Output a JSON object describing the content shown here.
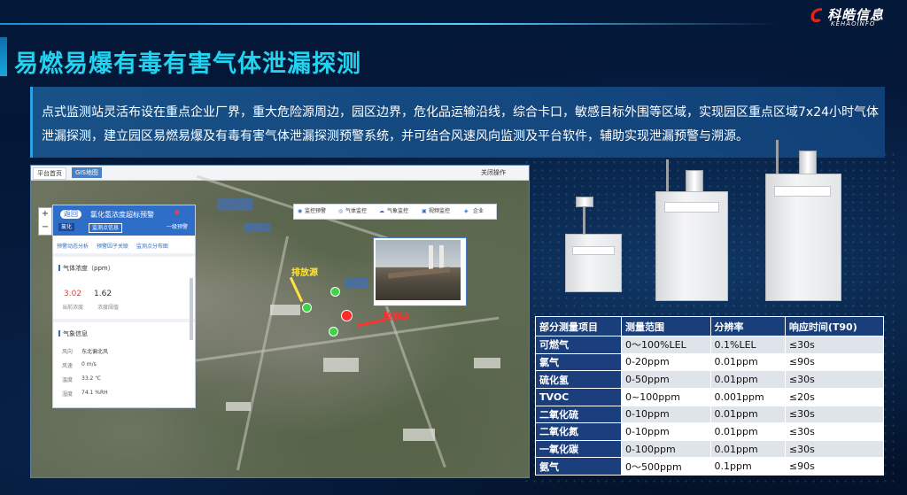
{
  "brand": {
    "name_cn": "科皓信息",
    "name_en": "KEHAOINFO",
    "color": "#e2231a"
  },
  "page": {
    "title": "易燃易爆有毒有害气体泄漏探测",
    "description": "点式监测站灵活布设在重点企业厂界，重大危险源周边，园区边界，危化品运输沿线，综合卡口，敏感目标外围等区域，实现园区重点区域7x24小时气体泄漏探测，建立园区易燃易爆及有毒有害气体泄漏探测预警系统，并可结合风速风向监测及平台软件，辅助实现泄漏预警与溯源。"
  },
  "app": {
    "tabs": [
      "平台首页",
      "GIS地图"
    ],
    "close_all": "关闭操作",
    "zoom_in": "+",
    "zoom_out": "−",
    "toolbar": [
      "监控预警",
      "气体监控",
      "气象监控",
      "视频监控",
      "企业"
    ],
    "panel": {
      "back_label": "返回",
      "alarm_title": "氯化氢浓度超标预警",
      "alarm_level": "一级预警",
      "chips": [
        "氯化",
        "监测点信息"
      ],
      "links": [
        "预警动态分析",
        "预警因子关联",
        "监测点分布图"
      ],
      "gas_section": "气体浓度（ppm）",
      "gas_current": "3.02",
      "gas_threshold": "1.62",
      "gas_current_label": "当前浓度",
      "gas_threshold_label": "浓度阈值",
      "weather_section": "气象信息",
      "weather": [
        {
          "k": "风向",
          "v": "东北偏北风"
        },
        {
          "k": "风速",
          "v": "0 m/s"
        },
        {
          "k": "温度",
          "v": "33.2 ℃"
        },
        {
          "k": "湿度",
          "v": "74.1 %RH"
        }
      ]
    },
    "map_labels": {
      "left": "排放源",
      "right": "监测点"
    }
  },
  "spec_table": {
    "headers": [
      "部分测量项目",
      "测量范围",
      "分辨率",
      "响应时间(T90)"
    ],
    "rows": [
      [
        "可燃气",
        "0～100%LEL",
        "0.1%LEL",
        "≤30s"
      ],
      [
        "氯气",
        "0-20ppm",
        "0.01ppm",
        "≤90s"
      ],
      [
        "硫化氢",
        " 0-50ppm",
        "0.01ppm",
        "≤30s"
      ],
      [
        "TVOC",
        "0~100ppm",
        "0.001ppm",
        "≤20s"
      ],
      [
        "二氧化硫",
        "0-10ppm",
        "0.01ppm",
        "≤30s"
      ],
      [
        "二氧化氮",
        "0-10ppm",
        "0.01ppm",
        "≤30s"
      ],
      [
        "一氧化碳",
        "0-100ppm",
        "0.01ppm",
        "≤30s"
      ],
      [
        "氨气",
        "0～500ppm",
        "0.1ppm",
        "≤90s"
      ]
    ]
  }
}
